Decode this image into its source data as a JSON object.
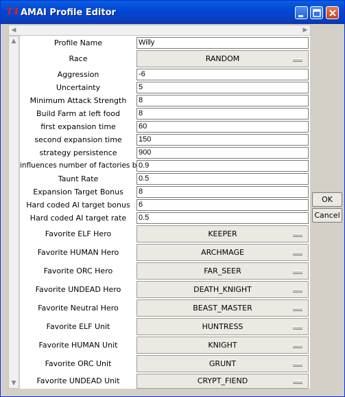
{
  "window": {
    "title": "AMAI Profile Editor",
    "app_icon": "T4"
  },
  "form": {
    "profile_name": {
      "label": "Profile Name",
      "value": "Willy"
    },
    "race": {
      "label": "Race",
      "value": "RANDOM"
    },
    "text_fields": [
      {
        "label": "Aggression",
        "value": "-6"
      },
      {
        "label": "Uncertainty",
        "value": "5"
      },
      {
        "label": "Minimum Attack Strength",
        "value": "8"
      },
      {
        "label": "Build Farm at left food",
        "value": "8"
      },
      {
        "label": "first expansion time",
        "value": "60"
      },
      {
        "label": "second expansion time",
        "value": "150"
      },
      {
        "label": "strategy persistence",
        "value": "900"
      },
      {
        "label": "influences number of factories built",
        "value": "0.9"
      },
      {
        "label": "Taunt Rate",
        "value": "0.5"
      },
      {
        "label": "Expansion Target Bonus",
        "value": "8"
      },
      {
        "label": "Hard coded AI target bonus",
        "value": "6"
      },
      {
        "label": "Hard coded AI target rate",
        "value": "0.5"
      }
    ],
    "selects": [
      {
        "label": "Favorite ELF Hero",
        "value": "KEEPER"
      },
      {
        "label": "Favorite HUMAN Hero",
        "value": "ARCHMAGE"
      },
      {
        "label": "Favorite ORC Hero",
        "value": "FAR_SEER"
      },
      {
        "label": "Favorite UNDEAD Hero",
        "value": "DEATH_KNIGHT"
      },
      {
        "label": "Favorite Neutral Hero",
        "value": "BEAST_MASTER"
      },
      {
        "label": "Favorite ELF Unit",
        "value": "HUNTRESS"
      },
      {
        "label": "Favorite HUMAN Unit",
        "value": "KNIGHT"
      },
      {
        "label": "Favorite ORC Unit",
        "value": "GRUNT"
      },
      {
        "label": "Favorite UNDEAD Unit",
        "value": "CRYPT_FIEND"
      }
    ]
  },
  "buttons": {
    "ok": "OK",
    "cancel": "Cancel"
  }
}
